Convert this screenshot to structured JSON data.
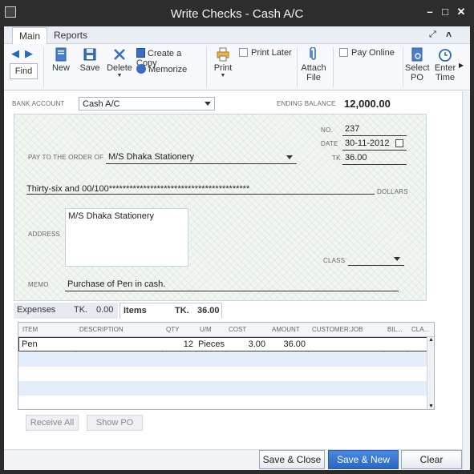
{
  "window": {
    "title": "Write Checks - Cash A/C"
  },
  "tabs": [
    {
      "label": "Main"
    },
    {
      "label": "Reports"
    }
  ],
  "ribbon": {
    "find": "Find",
    "new": "New",
    "save": "Save",
    "delete": "Delete",
    "create_copy": "Create a Copy",
    "memorize": "Memorize",
    "print": "Print",
    "print_later": "Print Later",
    "attach_line1": "Attach",
    "attach_line2": "File",
    "pay_online": "Pay Online",
    "select_po_line1": "Select",
    "select_po_line2": "PO",
    "enter_time_line1": "Enter",
    "enter_time_line2": "Time"
  },
  "bank": {
    "label": "BANK ACCOUNT",
    "value": "Cash A/C",
    "ending_label": "ENDING BALANCE",
    "ending_value": "12,000.00"
  },
  "check": {
    "no_label": "NO.",
    "no": "237",
    "date_label": "DATE",
    "date": "30-11-2012",
    "amount_label": "TK.",
    "amount": "36.00",
    "payto_label": "PAY TO THE ORDER OF",
    "payee": "M/S Dhaka Stationery",
    "amount_words": "Thirty-six and 00/100*****************************************",
    "dollars_label": "DOLLARS",
    "address_label": "ADDRESS",
    "address": "M/S Dhaka Stationery",
    "class_label": "CLASS",
    "class_value": "",
    "memo_label": "MEMO",
    "memo": "Purchase of Pen in cash."
  },
  "subtabs": {
    "expenses": "Expenses",
    "expenses_tk_label": "TK.",
    "expenses_tk": "0.00",
    "items": "Items",
    "items_tk_label": "TK.",
    "items_tk": "36.00"
  },
  "grid": {
    "headers": [
      "ITEM",
      "DESCRIPTION",
      "QTY",
      "U/M",
      "COST",
      "AMOUNT",
      "CUSTOMER:JOB",
      "BIL...",
      "CLA..."
    ],
    "rows": [
      {
        "item": "Pen",
        "description": "",
        "qty": "12",
        "um": "Pieces",
        "cost": "3.00",
        "amount": "36.00",
        "customer": "",
        "bil": "",
        "cla": ""
      }
    ]
  },
  "buttons": {
    "receive_all": "Receive All",
    "show_po": "Show PO",
    "save_close": "Save & Close",
    "save_new": "Save & New",
    "clear": "Clear"
  },
  "colors": {
    "accent": "#2a66c0",
    "titlebar": "#2d2d2d",
    "check_bg": "#f1f6f1"
  }
}
